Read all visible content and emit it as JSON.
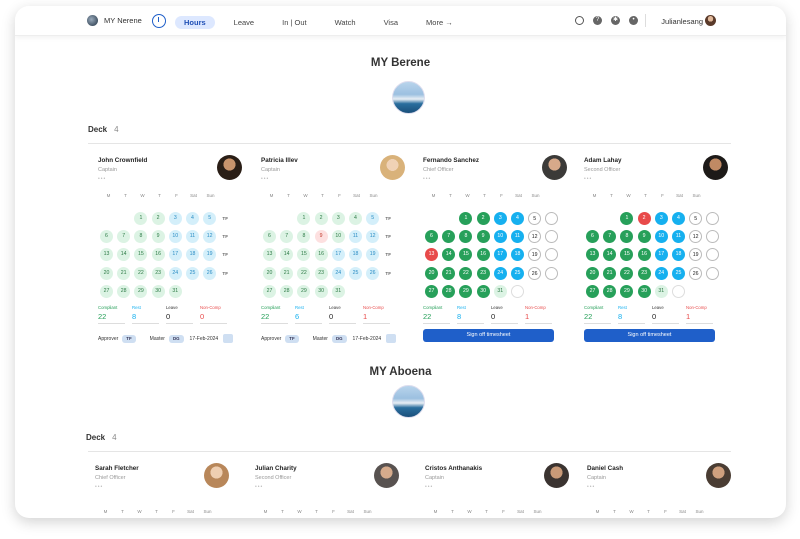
{
  "header": {
    "brand": "MY Nerene",
    "nav": [
      "Hours",
      "Leave",
      "In | Out",
      "Watch",
      "Visa",
      "More →"
    ],
    "active_nav": "Hours",
    "username": "Julianlesang",
    "icons": [
      "search-icon",
      "help-icon",
      "settings-icon",
      "notifications-icon"
    ]
  },
  "yachts": [
    {
      "title": "MY Berene",
      "deck_label": "Deck",
      "deck_count": "4"
    },
    {
      "title": "MY Aboena",
      "deck_label": "Deck",
      "deck_count": "4"
    }
  ],
  "weekdays": [
    "M",
    "T",
    "W",
    "T",
    "F",
    "Sat",
    "Sun"
  ],
  "crew_top": [
    {
      "name": "John Crownfield",
      "role": "Captain",
      "dots": "•••",
      "stats": [
        [
          "Compliant",
          "22"
        ],
        [
          "Rest",
          "8"
        ],
        [
          "Leave",
          "0"
        ],
        [
          "Non-Comp",
          "0"
        ]
      ],
      "approver": "Approver",
      "approver_initials": "TF",
      "master": "Master",
      "master_initials": "DG",
      "date": "17-Feb-2024"
    },
    {
      "name": "Patricia Illev",
      "role": "Captain",
      "dots": "•••",
      "stats": [
        [
          "Compliant",
          "22"
        ],
        [
          "Rest",
          "6"
        ],
        [
          "Leave",
          "0"
        ],
        [
          "Non-Comp",
          "1"
        ]
      ],
      "approver": "Approver",
      "approver_initials": "TF",
      "master": "Master",
      "master_initials": "DG",
      "date": "17-Feb-2024"
    },
    {
      "name": "Fernando Sanchez",
      "role": "Chief Officer",
      "dots": "•••",
      "stats": [
        [
          "Compliant",
          "22"
        ],
        [
          "Rest",
          "8"
        ],
        [
          "Leave",
          "0"
        ],
        [
          "Non-Comp",
          "1"
        ]
      ],
      "button": "Sign off timesheet"
    },
    {
      "name": "Adam Lahay",
      "role": "Second Officer",
      "dots": "•••",
      "stats": [
        [
          "Compliant",
          "22"
        ],
        [
          "Rest",
          "8"
        ],
        [
          "Leave",
          "0"
        ],
        [
          "Non-Comp",
          "1"
        ]
      ],
      "button": "Sign off timesheet"
    }
  ],
  "crew_bottom": [
    {
      "name": "Sarah Fletcher",
      "role": "Chief Officer",
      "dots": "•••"
    },
    {
      "name": "Julian Charity",
      "role": "Second Officer",
      "dots": "•••"
    },
    {
      "name": "Cristos Anthanakis",
      "role": "Captain",
      "dots": "•••"
    },
    {
      "name": "Daniel Cash",
      "role": "Captain",
      "dots": "•••"
    }
  ],
  "week_tag": "TF",
  "calendar_days": [
    [
      "",
      "",
      "1",
      "2",
      "3",
      "4",
      "5"
    ],
    [
      "6",
      "7",
      "8",
      "9",
      "10",
      "11",
      "12"
    ],
    [
      "13",
      "14",
      "15",
      "16",
      "17",
      "18",
      "19"
    ],
    [
      "20",
      "21",
      "22",
      "23",
      "24",
      "25",
      "26"
    ],
    [
      "27",
      "28",
      "29",
      "30",
      "31",
      "",
      ""
    ]
  ],
  "colors": {
    "accent": "#1f5fc9",
    "green": "#27a05a",
    "blue": "#16b0ef",
    "red": "#e84a4a"
  }
}
